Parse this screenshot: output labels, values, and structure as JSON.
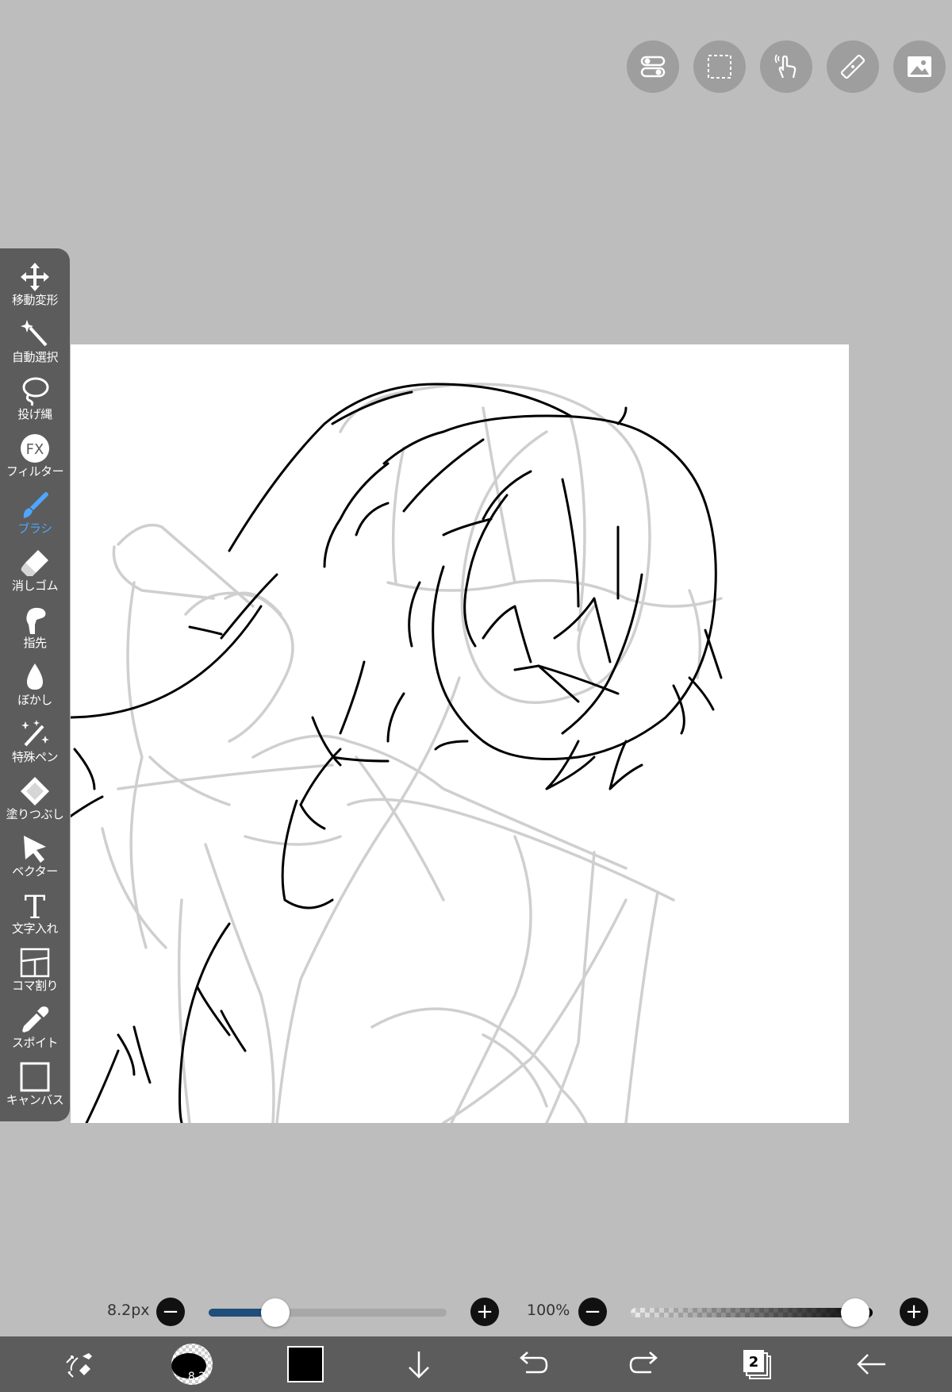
{
  "top_buttons": [
    {
      "name": "toggle-icon"
    },
    {
      "name": "selection-icon"
    },
    {
      "name": "touch-icon"
    },
    {
      "name": "ruler-icon"
    },
    {
      "name": "image-icon"
    }
  ],
  "tools": [
    {
      "name": "move-transform",
      "icon": "move-icon",
      "label": "移動変形",
      "active": false
    },
    {
      "name": "auto-select",
      "icon": "magic-wand-icon",
      "label": "自動選択",
      "active": false
    },
    {
      "name": "lasso",
      "icon": "lasso-icon",
      "label": "投げ縄",
      "active": false
    },
    {
      "name": "filter",
      "icon": "fx-icon",
      "label": "フィルター",
      "active": false
    },
    {
      "name": "brush",
      "icon": "brush-icon",
      "label": "ブラシ",
      "active": true
    },
    {
      "name": "eraser",
      "icon": "eraser-icon",
      "label": "消しゴム",
      "active": false
    },
    {
      "name": "finger",
      "icon": "finger-icon",
      "label": "指先",
      "active": false
    },
    {
      "name": "blur",
      "icon": "drop-icon",
      "label": "ぼかし",
      "active": false
    },
    {
      "name": "special-pen",
      "icon": "sparkle-pen-icon",
      "label": "特殊ペン",
      "active": false
    },
    {
      "name": "fill",
      "icon": "fill-icon",
      "label": "塗りつぶし",
      "active": false
    },
    {
      "name": "vector",
      "icon": "arrow-cursor-icon",
      "label": "ベクター",
      "active": false
    },
    {
      "name": "text",
      "icon": "text-icon",
      "label": "文字入れ",
      "active": false
    },
    {
      "name": "frame-divider",
      "icon": "panel-icon",
      "label": "コマ割り",
      "active": false
    },
    {
      "name": "eyedropper",
      "icon": "eyedropper-icon",
      "label": "スポイト",
      "active": false
    },
    {
      "name": "canvas",
      "icon": "canvas-icon",
      "label": "キャンバス",
      "active": false
    }
  ],
  "brush": {
    "size_label": "8.2px",
    "size_fraction": 0.28,
    "preview_label": "8.2"
  },
  "opacity": {
    "label": "100%",
    "fraction": 1.0
  },
  "colors": {
    "current_color": "#000000",
    "active_tool": "#4da6ff",
    "size_fill": "#1f4e7a"
  },
  "layers": {
    "count": "2"
  },
  "bottom_buttons": [
    {
      "name": "swap-icon"
    },
    {
      "name": "brush-preview"
    },
    {
      "name": "color-swatch"
    },
    {
      "name": "download-icon"
    },
    {
      "name": "undo-icon"
    },
    {
      "name": "redo-icon"
    },
    {
      "name": "layers-icon"
    },
    {
      "name": "back-icon"
    }
  ]
}
